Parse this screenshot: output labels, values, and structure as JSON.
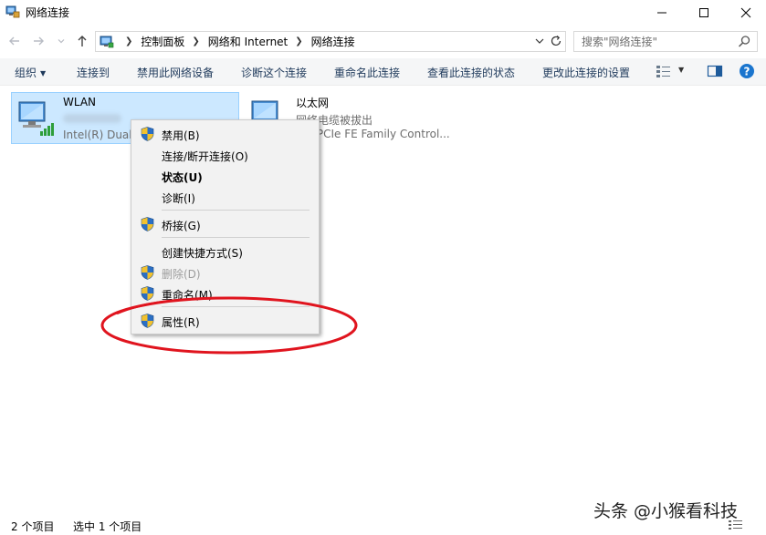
{
  "window": {
    "title": "网络连接",
    "controls": {
      "minimize": "—",
      "maximize": "☐",
      "close": "✕"
    }
  },
  "address": {
    "crumbs": [
      "控制面板",
      "网络和 Internet",
      "网络连接"
    ],
    "search_placeholder": "搜索\"网络连接\""
  },
  "commands": [
    {
      "label": "组织"
    },
    {
      "label": "连接到"
    },
    {
      "label": "禁用此网络设备"
    },
    {
      "label": "诊断这个连接"
    },
    {
      "label": "重命名此连接"
    },
    {
      "label": "查看此连接的状态"
    },
    {
      "label": "更改此连接的设置"
    }
  ],
  "connections": [
    {
      "name": "WLAN",
      "status": "",
      "device": "Intel(R) Dual",
      "selected": true
    },
    {
      "name": "以太网",
      "status": "网络电缆被拔出",
      "device": "tek PCIe FE Family Control...",
      "selected": false
    }
  ],
  "context_menu": {
    "items": [
      {
        "label": "禁用(B)",
        "shield": true
      },
      {
        "label": "连接/断开连接(O)",
        "shield": false
      },
      {
        "label": "状态(U)",
        "shield": false,
        "bold": true
      },
      {
        "label": "诊断(I)",
        "shield": false
      },
      {
        "label": "桥接(G)",
        "shield": true
      },
      {
        "label": "创建快捷方式(S)",
        "shield": false
      },
      {
        "label": "删除(D)",
        "shield": true,
        "disabled": true
      },
      {
        "label": "重命名(M)",
        "shield": true
      },
      {
        "label": "属性(R)",
        "shield": true
      }
    ]
  },
  "status": {
    "item_count": "2 个项目",
    "selected_count": "选中 1 个项目"
  },
  "watermark": "头条 @小猴看科技",
  "colors": {
    "selection_bg": "#cce8ff",
    "selection_border": "#99d1ff",
    "annotation": "#e0141e",
    "command_text": "#1e395b",
    "help": "#1a75ce"
  }
}
